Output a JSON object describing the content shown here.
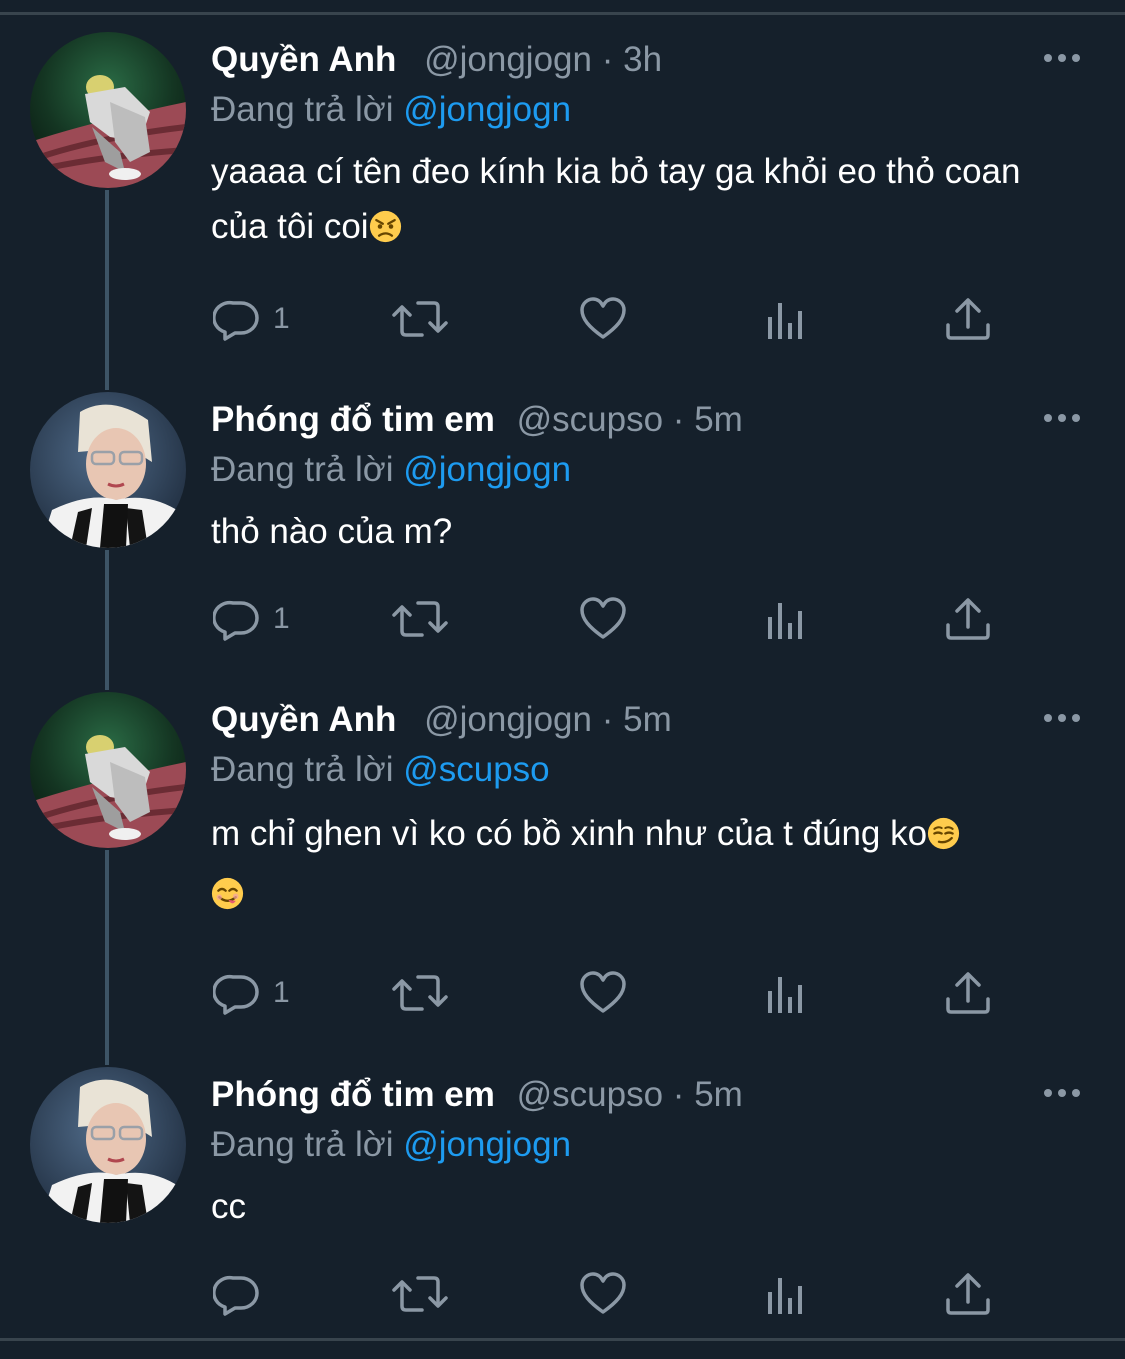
{
  "replying_prefix": "Đang trả lời",
  "colors": {
    "background": "#15202b",
    "name": "#ffffff",
    "secondary": "#8b98a5",
    "mention": "#1d9bf0",
    "thread_line": "#3d5466"
  },
  "tweets": [
    {
      "name": "Quyền Anh",
      "handle": "@jongjogn",
      "separator": "·",
      "time": "3h",
      "replying_to": "@jongjogn",
      "text": "yaaaa cí tên đeo kính kia bỏ tay ga khỏi eo thỏ coan của tôi coi",
      "emoji_after": "angry-face-emoji",
      "reply_count": "1",
      "avatar": "quyen-anh-avatar"
    },
    {
      "name": "Phóng đổ tim em",
      "handle": "@scupso",
      "separator": "·",
      "time": "5m",
      "replying_to": "@jongjogn",
      "text": "thỏ nào của m?",
      "reply_count": "1",
      "avatar": "phong-avatar"
    },
    {
      "name": "Quyền Anh",
      "handle": "@jongjogn",
      "separator": "·",
      "time": "5m",
      "replying_to": "@scupso",
      "text": "m chỉ ghen vì ko có bồ xinh như của t đúng ko",
      "emoji_after": "smirking-face-emoji",
      "emoji_line2": "yum-face-emoji",
      "reply_count": "1",
      "avatar": "quyen-anh-avatar"
    },
    {
      "name": "Phóng đổ tim em",
      "handle": "@scupso",
      "separator": "·",
      "time": "5m",
      "replying_to": "@jongjogn",
      "text": "cc",
      "reply_count": "",
      "avatar": "phong-avatar"
    }
  ]
}
